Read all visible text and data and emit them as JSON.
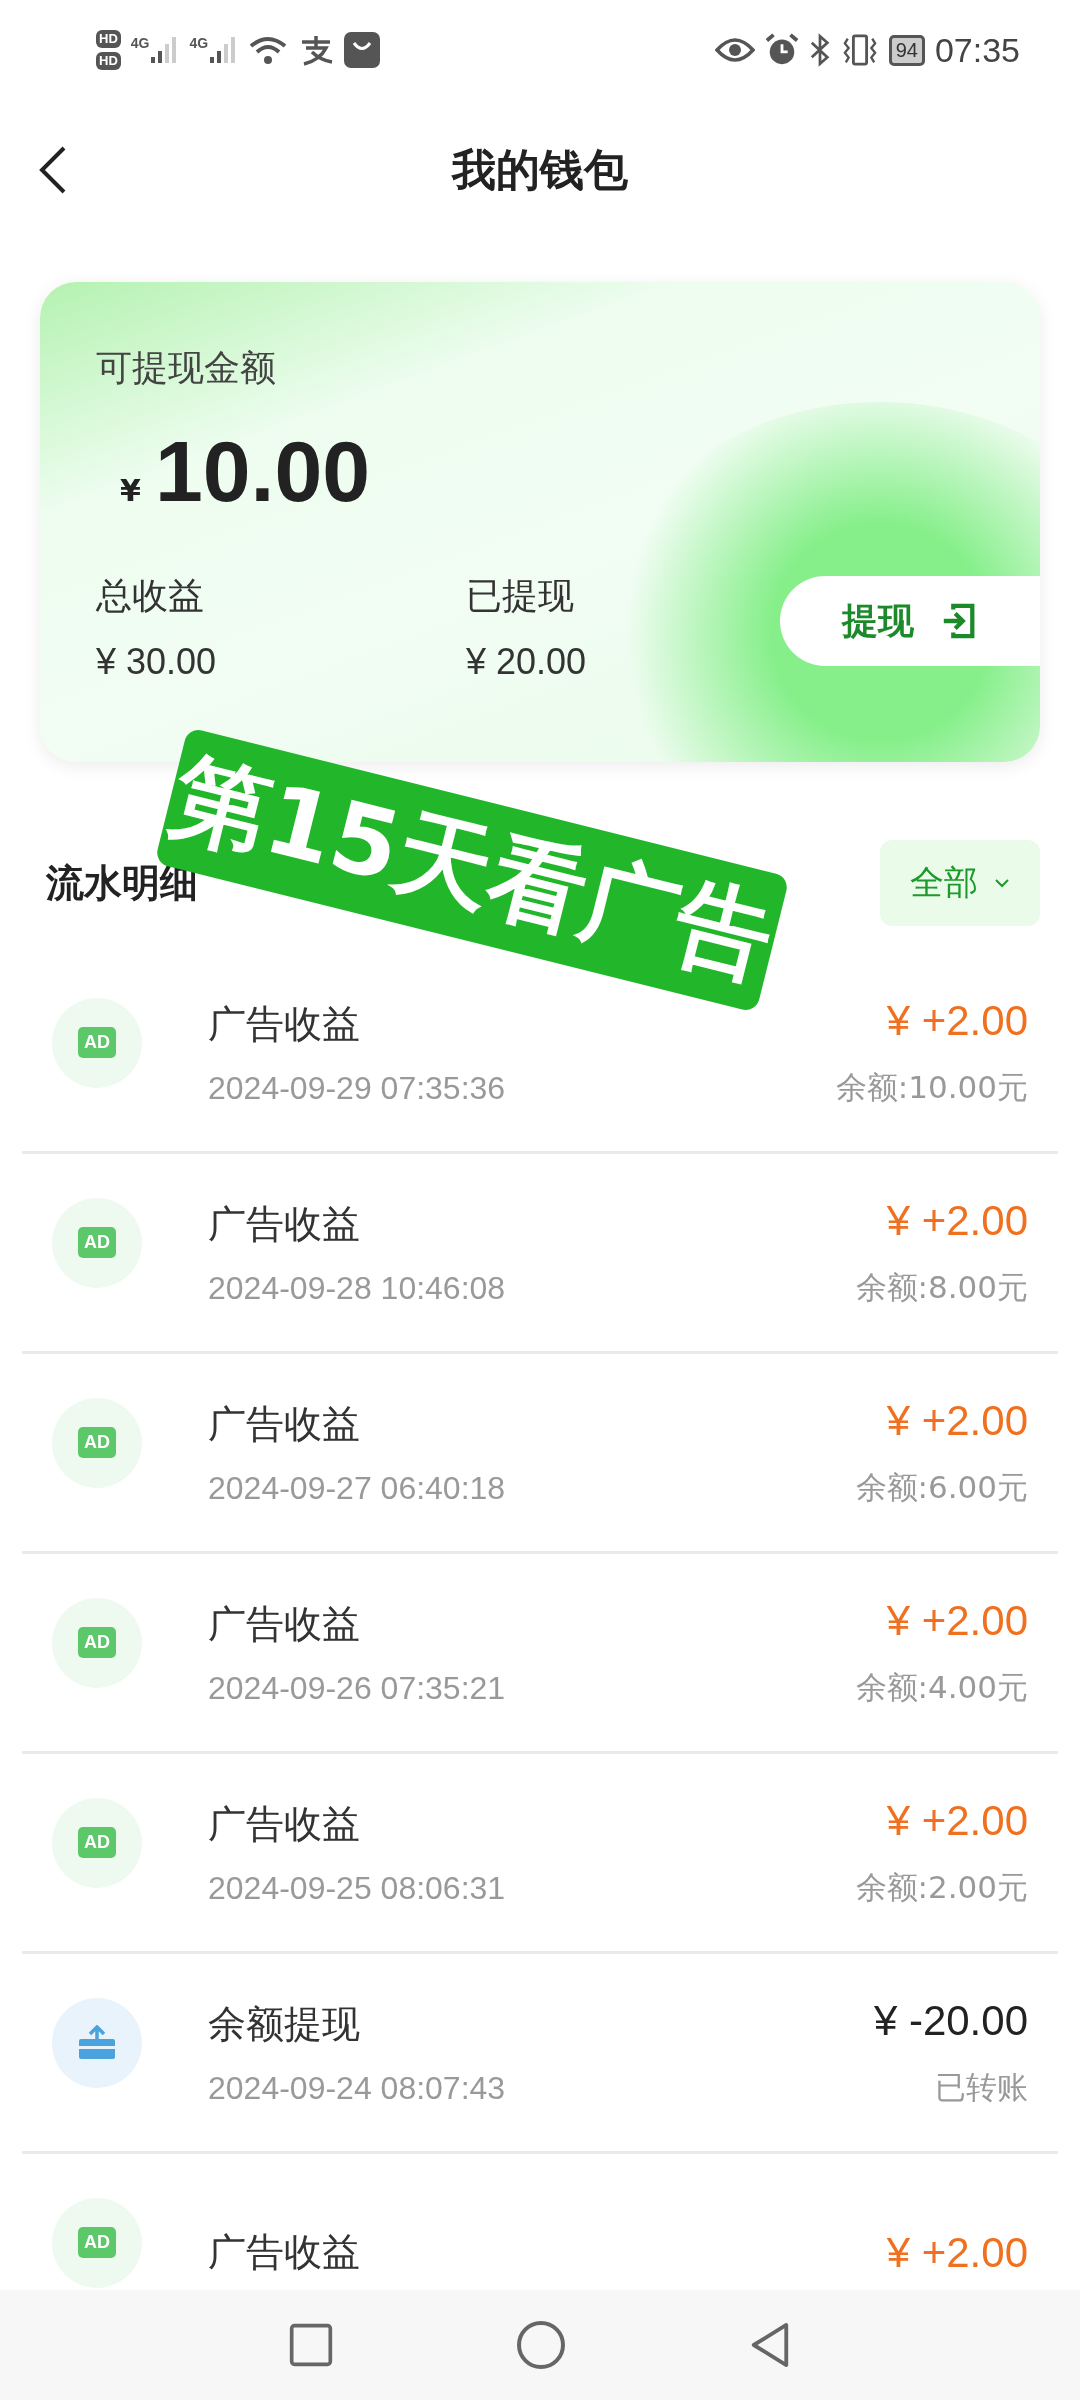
{
  "status_bar": {
    "sim_labels": [
      "HD",
      "HD"
    ],
    "network_labels": [
      "4G",
      "4G"
    ],
    "battery": "94",
    "time": "07:35"
  },
  "header": {
    "title": "我的钱包"
  },
  "wallet_card": {
    "label": "可提现金额",
    "currency": "¥",
    "amount": "10.00",
    "stats": [
      {
        "label": "总收益",
        "value": "¥ 30.00"
      },
      {
        "label": "已提现",
        "value": "¥ 20.00"
      }
    ],
    "withdraw_button": "提现"
  },
  "sticker": "第15天看广告",
  "transactions": {
    "title": "流水明细",
    "filter": "全部",
    "items": [
      {
        "kind": "ad",
        "icon_text": "AD",
        "title": "广告收益",
        "date": "2024-09-29 07:35:36",
        "amount": "¥ +2.00",
        "note": "余额:10.00元"
      },
      {
        "kind": "ad",
        "icon_text": "AD",
        "title": "广告收益",
        "date": "2024-09-28 10:46:08",
        "amount": "¥ +2.00",
        "note": "余额:8.00元"
      },
      {
        "kind": "ad",
        "icon_text": "AD",
        "title": "广告收益",
        "date": "2024-09-27 06:40:18",
        "amount": "¥ +2.00",
        "note": "余额:6.00元"
      },
      {
        "kind": "ad",
        "icon_text": "AD",
        "title": "广告收益",
        "date": "2024-09-26 07:35:21",
        "amount": "¥ +2.00",
        "note": "余额:4.00元"
      },
      {
        "kind": "ad",
        "icon_text": "AD",
        "title": "广告收益",
        "date": "2024-09-25 08:06:31",
        "amount": "¥ +2.00",
        "note": "余额:2.00元"
      },
      {
        "kind": "withdraw",
        "title": "余额提现",
        "date": "2024-09-24 08:07:43",
        "amount": "¥ -20.00",
        "note": "已转账"
      },
      {
        "kind": "ad",
        "icon_text": "AD",
        "title": "广告收益",
        "amount": "¥ +2.00"
      }
    ]
  }
}
